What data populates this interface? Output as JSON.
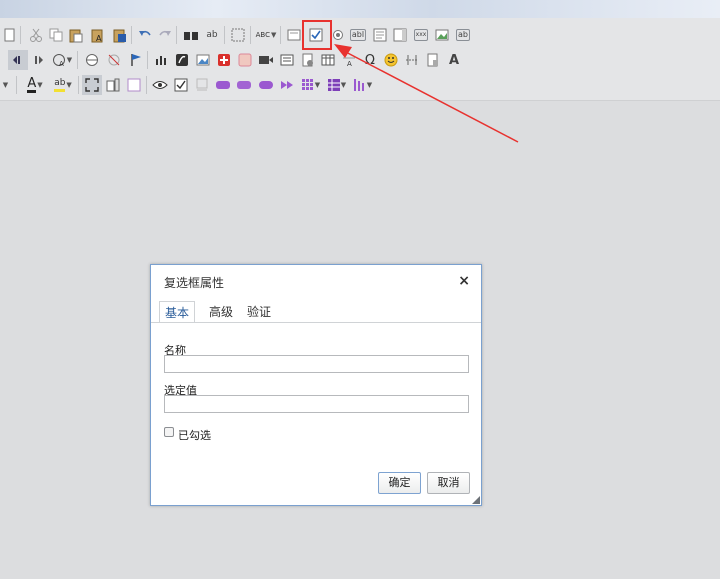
{
  "dialog": {
    "title": "复选框属性",
    "close_symbol": "×",
    "tabs": [
      "基本",
      "高级",
      "验证"
    ],
    "fields": {
      "name_label": "名称",
      "name_value": "",
      "value_label": "选定值",
      "value_value": ""
    },
    "checkbox_label": "已勾选",
    "ok_label": "确定",
    "cancel_label": "取消"
  },
  "toolbar": {
    "row1_icons": [
      "new-page-icon",
      "cut-icon",
      "copy-icon",
      "paste-icon",
      "paste-text-icon",
      "paste-word-icon",
      "undo-icon",
      "redo-icon",
      "find-icon",
      "replace-icon",
      "select-all-icon",
      "spellcheck-icon",
      "form-icon",
      "checkbox-icon",
      "radio-icon",
      "textfield-icon",
      "textarea-icon",
      "select-icon",
      "button-icon",
      "image-button-icon",
      "hidden-field-icon"
    ],
    "row2_icons": [
      "ltr-icon",
      "rtl-icon",
      "language-icon",
      "link-icon",
      "unlink-icon",
      "anchor-icon",
      "chart-icon",
      "flash-icon",
      "image-icon",
      "plus-icon",
      "media-icon",
      "video-icon",
      "template-icon",
      "doc-icon",
      "table-icon",
      "horizontal-line-icon",
      "special-char-icon",
      "smiley-icon",
      "page-break-icon",
      "iframe-icon",
      "style-icon"
    ],
    "row3_icons": [
      "text-color-icon",
      "bg-color-icon",
      "maximize-icon",
      "show-blocks-icon",
      "source-icon",
      "preview-icon",
      "checklist-icon",
      "frame-icon",
      "tag-icon",
      "badge-icon",
      "oval-icon",
      "pill-icon",
      "arrows-icon",
      "grid-icon",
      "table2-icon",
      "list-icon"
    ],
    "abc_glyph": "ABC",
    "ab_glyph": "ab",
    "abl_glyph": "abl",
    "xxx_glyph": "xxx",
    "a_glyph": "A",
    "omega_glyph": "Ω",
    "checkmark_glyph": "✓"
  },
  "colors": {
    "accent_red": "#e8322f",
    "dialog_border": "#7aa0cf",
    "active_tab_text": "#2a5c9a"
  }
}
